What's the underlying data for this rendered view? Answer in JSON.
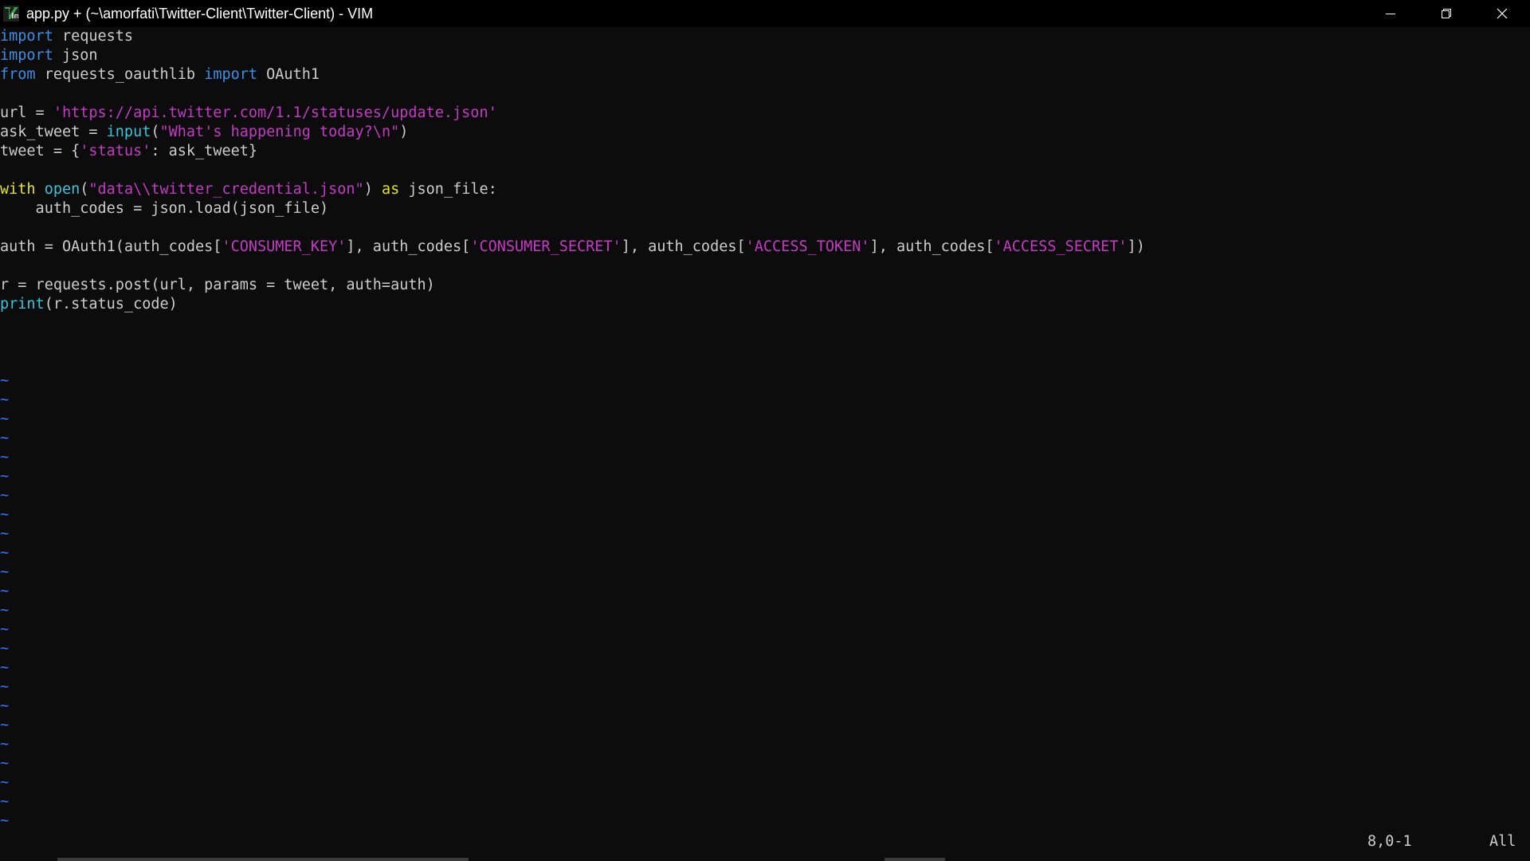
{
  "window": {
    "title": "app.py + (~\\amorfati\\Twitter-Client\\Twitter-Client) - VIM",
    "icon": "vim-icon",
    "controls": [
      "minimize-icon",
      "restore-icon",
      "close-icon"
    ]
  },
  "colors": {
    "background": "#0c0c0c",
    "titlebar": "#000000",
    "text": "#cccccc",
    "keyword": "#3b8eea",
    "string": "#c639c6",
    "builtin": "#38c2dc",
    "control": "#e5e510",
    "tilde": "#3b78ff"
  },
  "editor": {
    "lines": [
      [
        {
          "t": "keyword",
          "v": "import"
        },
        {
          "t": "plain",
          "v": " requests"
        }
      ],
      [
        {
          "t": "keyword",
          "v": "import"
        },
        {
          "t": "plain",
          "v": " json"
        }
      ],
      [
        {
          "t": "keyword",
          "v": "from"
        },
        {
          "t": "plain",
          "v": " requests_oauthlib "
        },
        {
          "t": "keyword",
          "v": "import"
        },
        {
          "t": "plain",
          "v": " OAuth1"
        }
      ],
      [],
      [
        {
          "t": "plain",
          "v": "url = "
        },
        {
          "t": "string",
          "v": "'https://api.twitter.com/1.1/statuses/update.json'"
        }
      ],
      [
        {
          "t": "plain",
          "v": "ask_tweet = "
        },
        {
          "t": "builtin",
          "v": "input"
        },
        {
          "t": "plain",
          "v": "("
        },
        {
          "t": "string",
          "v": "\"What's happening today?\\n\""
        },
        {
          "t": "plain",
          "v": ")"
        }
      ],
      [
        {
          "t": "plain",
          "v": "tweet = {"
        },
        {
          "t": "string",
          "v": "'status'"
        },
        {
          "t": "plain",
          "v": ": ask_tweet}"
        }
      ],
      [],
      [
        {
          "t": "control",
          "v": "with"
        },
        {
          "t": "plain",
          "v": " "
        },
        {
          "t": "builtin",
          "v": "open"
        },
        {
          "t": "plain",
          "v": "("
        },
        {
          "t": "string",
          "v": "\"data\\\\twitter_credential.json\""
        },
        {
          "t": "plain",
          "v": ") "
        },
        {
          "t": "control",
          "v": "as"
        },
        {
          "t": "plain",
          "v": " json_file:"
        }
      ],
      [
        {
          "t": "plain",
          "v": "    auth_codes = json.load(json_file)"
        }
      ],
      [],
      [
        {
          "t": "plain",
          "v": "auth = OAuth1(auth_codes["
        },
        {
          "t": "string",
          "v": "'CONSUMER_KEY'"
        },
        {
          "t": "plain",
          "v": "], auth_codes["
        },
        {
          "t": "string",
          "v": "'CONSUMER_SECRET'"
        },
        {
          "t": "plain",
          "v": "], auth_codes["
        },
        {
          "t": "string",
          "v": "'ACCESS_TOKEN'"
        },
        {
          "t": "plain",
          "v": "], auth_codes["
        },
        {
          "t": "string",
          "v": "'ACCESS_SECRET'"
        },
        {
          "t": "plain",
          "v": "])"
        }
      ],
      [],
      [
        {
          "t": "plain",
          "v": "r = requests.post(url, params = tweet, auth=auth)"
        }
      ],
      [
        {
          "t": "builtin",
          "v": "print"
        },
        {
          "t": "plain",
          "v": "(r.status_code)"
        }
      ],
      [],
      [],
      []
    ],
    "tilde_char": "~",
    "tilde_count": 25
  },
  "status": {
    "cursor_position": "8,0-1",
    "scroll_percent": "All"
  }
}
